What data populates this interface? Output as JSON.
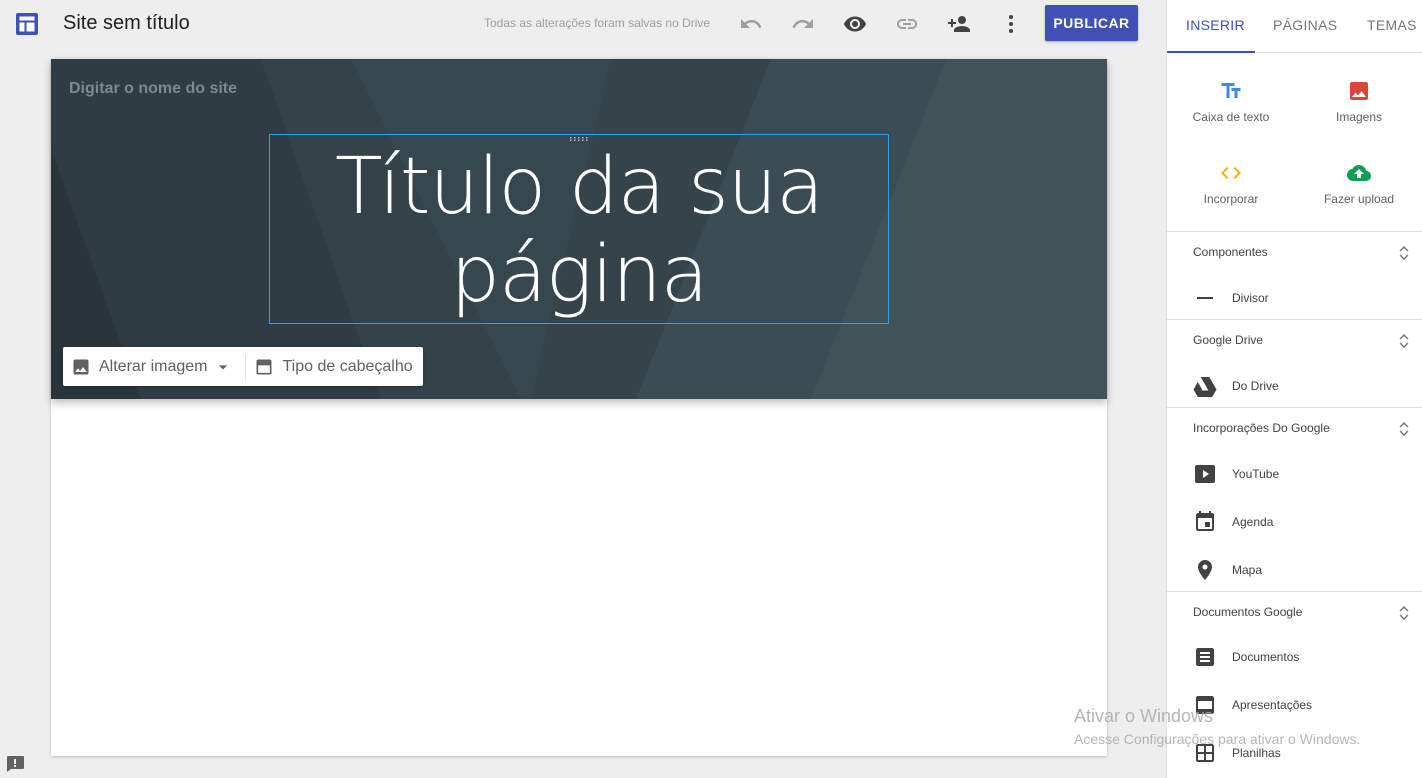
{
  "topbar": {
    "site_title": "Site sem título",
    "save_status": "Todas as alterações foram salvas no Drive",
    "publish_label": "PUBLICAR",
    "icons": [
      "undo-icon",
      "redo-icon",
      "preview-icon",
      "link-icon",
      "share-icon",
      "more-vert-icon"
    ]
  },
  "header": {
    "site_name_placeholder": "Digitar o nome do site",
    "title_line1": "Título da sua",
    "title_line2": "página",
    "change_image_label": "Alterar imagem",
    "header_type_label": "Tipo de cabeçalho"
  },
  "panel": {
    "tabs": [
      {
        "label": "INSERIR",
        "active": true
      },
      {
        "label": "PÁGINAS",
        "active": false
      },
      {
        "label": "TEMAS",
        "active": false
      }
    ],
    "insert_tiles": [
      {
        "label": "Caixa de texto",
        "icon": "text-box-icon",
        "color": "#4285f4"
      },
      {
        "label": "Imagens",
        "icon": "image-icon",
        "color": "#db4437"
      },
      {
        "label": "Incorporar",
        "icon": "embed-icon",
        "color": "#f4b400"
      },
      {
        "label": "Fazer upload",
        "icon": "upload-icon",
        "color": "#0f9d58"
      }
    ],
    "sections": [
      {
        "title": "Componentes",
        "items": [
          {
            "label": "Divisor",
            "icon": "divider-icon"
          }
        ]
      },
      {
        "title": "Google Drive",
        "items": [
          {
            "label": "Do Drive",
            "icon": "drive-icon"
          }
        ]
      },
      {
        "title": "Incorporações Do Google",
        "items": [
          {
            "label": "YouTube",
            "icon": "youtube-icon"
          },
          {
            "label": "Agenda",
            "icon": "calendar-icon"
          },
          {
            "label": "Mapa",
            "icon": "map-pin-icon"
          }
        ]
      },
      {
        "title": "Documentos Google",
        "items": [
          {
            "label": "Documentos",
            "icon": "docs-icon"
          },
          {
            "label": "Apresentações",
            "icon": "slides-icon"
          },
          {
            "label": "Planilhas",
            "icon": "sheets-icon"
          }
        ]
      }
    ]
  },
  "watermark": {
    "line1": "Ativar o Windows",
    "line2": "Acesse Configurações para ativar o Windows."
  },
  "colors": {
    "accent": "#3f51b5",
    "header_bg": "#37474f",
    "selection": "#29a0e8"
  }
}
